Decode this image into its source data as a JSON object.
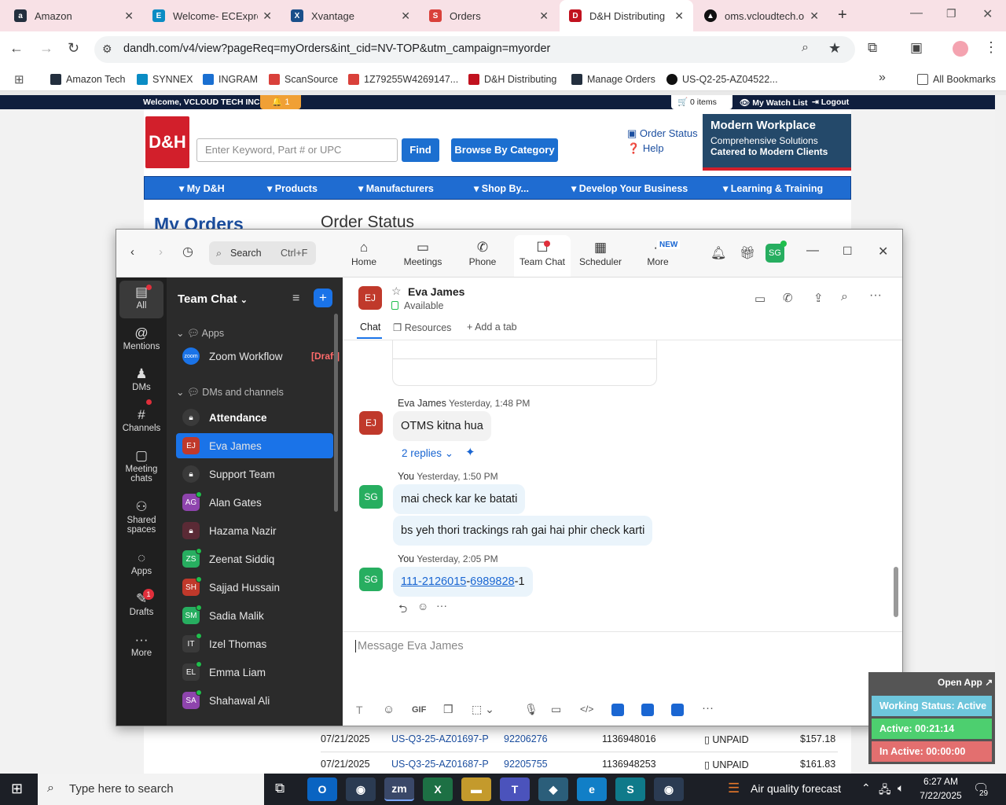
{
  "browser": {
    "tabs": [
      {
        "label": "Amazon",
        "color": "#232f3e",
        "glyph": "a"
      },
      {
        "label": "Welcome- ECExpre",
        "color": "#0a8cc4",
        "glyph": "E"
      },
      {
        "label": "Xvantage",
        "color": "#1a4f8a",
        "glyph": "X"
      },
      {
        "label": "Orders",
        "color": "#d9413b",
        "glyph": "S"
      },
      {
        "label": "D&H Distributing",
        "color": "#c1121f",
        "glyph": "D"
      },
      {
        "label": "oms.vcloudtech.org",
        "color": "#111111",
        "glyph": "▲"
      }
    ],
    "url": "dandh.com/v4/view?pageReq=myOrders&int_cid=NV-TOP&utm_campaign=myorder",
    "bookmarks": [
      {
        "label": "Amazon Tech",
        "color": "#232f3e"
      },
      {
        "label": "SYNNEX",
        "color": "#0a8cc4"
      },
      {
        "label": "INGRAM",
        "color": "#1a6fd1"
      },
      {
        "label": "ScanSource",
        "color": "#d9413b"
      },
      {
        "label": "1Z79255W4269147...",
        "color": "#d9413b"
      },
      {
        "label": "D&H Distributing",
        "color": "#c1121f"
      },
      {
        "label": "Manage Orders",
        "color": "#232f3e"
      },
      {
        "label": "US-Q2-25-AZ04522...",
        "color": "#111111"
      }
    ],
    "all_bookmarks": "All Bookmarks"
  },
  "site": {
    "welcome": "Welcome, VCLOUD TECH INC",
    "alert_count": "1",
    "cart": "0 items",
    "watch_list": "My Watch List",
    "logout": "Logout",
    "logo": "D&H",
    "search_placeholder": "Enter Keyword, Part # or UPC",
    "find": "Find",
    "browse": "Browse By Category",
    "order_status_link": "Order Status",
    "help": "Help",
    "banner_title": "Modern Workplace",
    "banner_sub1": "Comprehensive Solutions",
    "banner_sub2": "Catered to Modern Clients",
    "nav": [
      "My D&H",
      "Products",
      "Manufacturers",
      "Shop By...",
      "Develop Your Business",
      "Learning & Training"
    ],
    "my_orders": "My Orders",
    "order_status_heading": "Order Status",
    "rows": [
      {
        "date": "07/21/2025",
        "po": "US-Q3-25-AZ01697-P",
        "order": "92206276",
        "invoice": "1136948016",
        "status": "UNPAID",
        "amount": "$157.18"
      },
      {
        "date": "07/21/2025",
        "po": "US-Q3-25-AZ01687-P",
        "order": "92205755",
        "invoice": "1136948253",
        "status": "UNPAID",
        "amount": "$161.83"
      }
    ]
  },
  "zoom": {
    "search_label": "Search",
    "search_shortcut": "Ctrl+F",
    "nav": [
      {
        "label": "Home",
        "icon": "home-icon",
        "glyph": "⌂"
      },
      {
        "label": "Meetings",
        "icon": "video-icon",
        "glyph": "▭"
      },
      {
        "label": "Phone",
        "icon": "phone-icon",
        "glyph": "✆"
      },
      {
        "label": "Team Chat",
        "icon": "chat-icon",
        "glyph": "☐"
      },
      {
        "label": "Scheduler",
        "icon": "calendar-icon",
        "glyph": "▦"
      },
      {
        "label": "More",
        "icon": "more-icon",
        "glyph": "··"
      }
    ],
    "new_badge": "NEW",
    "profile_initials": "SG",
    "rail": [
      {
        "label": "All",
        "glyph": "▤"
      },
      {
        "label": "Mentions",
        "glyph": "@"
      },
      {
        "label": "DMs",
        "glyph": "♟"
      },
      {
        "label": "Channels",
        "glyph": "#"
      },
      {
        "label": "Meeting chats",
        "glyph": "▢"
      },
      {
        "label": "Shared spaces",
        "glyph": "⚇"
      },
      {
        "label": "Apps",
        "glyph": "◌"
      },
      {
        "label": "Drafts",
        "glyph": "✎"
      },
      {
        "label": "More",
        "glyph": "···"
      }
    ],
    "drafts_badge": "1",
    "sidebar_title": "Team Chat",
    "sections": {
      "apps": "Apps",
      "dms": "DMs and channels"
    },
    "zoom_workflow": "Zoom Workflow",
    "draft_tag": "[Draft]",
    "channels": [
      {
        "name": "Attendance",
        "initials": "",
        "color": "#3a3a3a",
        "bold": true
      },
      {
        "name": "Eva James",
        "initials": "EJ",
        "color": "#c0392b",
        "selected": true
      },
      {
        "name": "Support Team",
        "initials": "",
        "color": "#3a3a3a"
      },
      {
        "name": "Alan Gates",
        "initials": "AG",
        "color": "#8e44ad"
      },
      {
        "name": "Hazama Nazir",
        "initials": "",
        "color": "#5a2a35"
      },
      {
        "name": "Zeenat Siddiq",
        "initials": "ZS",
        "color": "#27ae60"
      },
      {
        "name": "Sajjad Hussain",
        "initials": "SH",
        "color": "#c0392b"
      },
      {
        "name": "Sadia Malik",
        "initials": "SM",
        "color": "#27ae60"
      },
      {
        "name": "Izel Thomas",
        "initials": "IT",
        "color": "#3a3a3a"
      },
      {
        "name": "Emma Liam",
        "initials": "EL",
        "color": "#3a3a3a"
      },
      {
        "name": "Shahawal Ali",
        "initials": "SA",
        "color": "#8e44ad"
      }
    ],
    "chat": {
      "contact_initials": "EJ",
      "contact_name": "Eva James",
      "presence": "Available",
      "tabs": [
        "Chat",
        "Resources",
        "Add a tab"
      ],
      "messages": [
        {
          "author": "Eva James",
          "time": "Yesterday, 1:48 PM",
          "initials": "EJ",
          "text": "OTMS kitna hua"
        },
        {
          "author": "You",
          "time": "Yesterday, 1:50 PM",
          "initials": "SG",
          "text": "mai check kar ke batati",
          "text2": "bs yeh thori trackings rah gai hai phir check karti"
        },
        {
          "author": "You",
          "time": "Yesterday, 2:05 PM",
          "initials": "SG",
          "link1": "111-2126015",
          "sep": "-",
          "link2": "6989828",
          "tail": "-1"
        }
      ],
      "replies": "2 replies",
      "composer_placeholder": "Message Eva James",
      "gif": "GIF"
    }
  },
  "status_widget": {
    "open_app": "Open App ↗",
    "working": "Working Status: Active",
    "active": "Active: 00:21:14",
    "inactive": "In Active: 00:00:00"
  },
  "taskbar": {
    "search_placeholder": "Type here to search",
    "weather": "Air quality forecast",
    "time": "6:27 AM",
    "date": "7/22/2025",
    "notifications": "29"
  }
}
